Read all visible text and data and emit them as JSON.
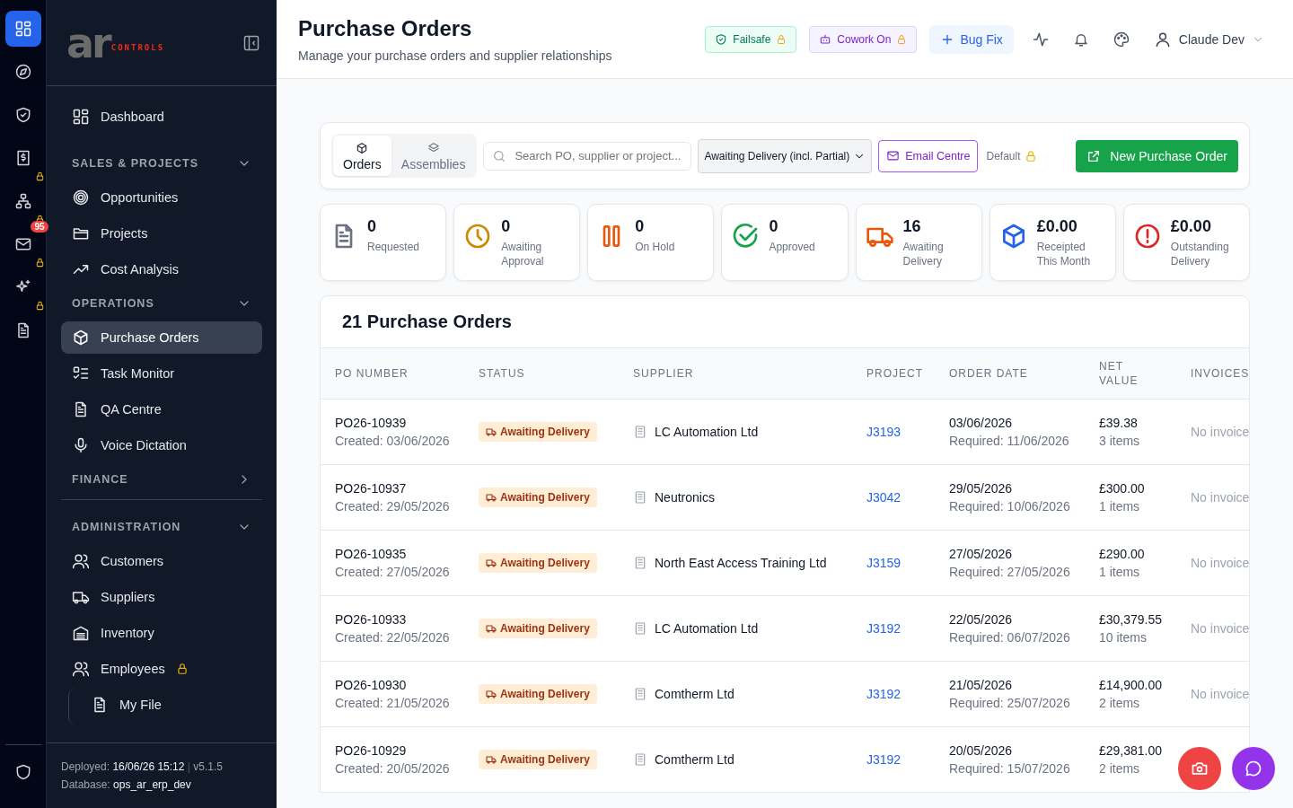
{
  "rail": {
    "items": [
      {
        "selected": true,
        "locked": false
      },
      {
        "selected": false,
        "locked": false
      },
      {
        "selected": false,
        "locked": false
      },
      {
        "selected": false,
        "locked": true
      },
      {
        "selected": false,
        "locked": true
      },
      {
        "selected": false,
        "locked": true,
        "badge": "95"
      },
      {
        "selected": false,
        "locked": true
      },
      {
        "selected": false,
        "locked": false
      }
    ]
  },
  "sidebar": {
    "logo": {
      "mark": "ar",
      "word": "CONTROLS"
    },
    "nav": [
      {
        "kind": "item",
        "label": "Dashboard",
        "selected": false,
        "locked": false
      },
      {
        "kind": "section",
        "label": "SALES & PROJECTS",
        "expanded": true,
        "children": [
          {
            "label": "Opportunities",
            "selected": false,
            "locked": false
          },
          {
            "label": "Projects",
            "selected": false,
            "locked": false
          },
          {
            "label": "Cost Analysis",
            "selected": false,
            "locked": false
          }
        ]
      },
      {
        "kind": "section",
        "label": "OPERATIONS",
        "expanded": true,
        "children": [
          {
            "label": "Purchase Orders",
            "selected": true,
            "locked": false
          },
          {
            "label": "Task Monitor",
            "selected": false,
            "locked": false
          },
          {
            "label": "QA Centre",
            "selected": false,
            "locked": false
          },
          {
            "label": "Voice Dictation",
            "selected": false,
            "locked": false
          }
        ]
      },
      {
        "kind": "section",
        "label": "FINANCE",
        "expanded": false
      },
      {
        "kind": "divider"
      },
      {
        "kind": "section",
        "label": "ADMINISTRATION",
        "expanded": true,
        "children": [
          {
            "label": "Customers",
            "selected": false,
            "locked": false
          },
          {
            "label": "Suppliers",
            "selected": false,
            "locked": false
          },
          {
            "label": "Inventory",
            "selected": false,
            "locked": false
          },
          {
            "label": "Employees",
            "selected": false,
            "locked": true,
            "children": [
              {
                "label": "My File",
                "selected": false,
                "locked": false
              }
            ]
          }
        ]
      }
    ],
    "footer": {
      "deployed_label": "Deployed:",
      "deployed": "16/06/26 15:12",
      "separator": "|",
      "version": "v5.1.5",
      "database_label": "Database:",
      "database": "ops_ar_erp_dev"
    }
  },
  "header": {
    "title": "Purchase Orders",
    "subtitle": "Manage your purchase orders and supplier relationships",
    "badges": [
      {
        "label": "Failsafe",
        "kind": "failsafe",
        "locked": true
      },
      {
        "label": "Cowork On",
        "kind": "cowork",
        "locked": true
      }
    ],
    "bug_fix": {
      "label": "Bug Fix"
    },
    "user": {
      "name": "Claude Dev"
    }
  },
  "toolbar": {
    "tabs": [
      {
        "label": "Orders",
        "selected": true
      },
      {
        "label": "Assemblies",
        "selected": false
      }
    ],
    "search": {
      "placeholder": "Search PO, supplier or project..."
    },
    "status_filter": {
      "value": "Awaiting Delivery (incl. Partial)"
    },
    "email_centre": {
      "label": "Email Centre"
    },
    "view": {
      "label": "Default",
      "locked": true
    },
    "new_button": {
      "label": "New Purchase Order"
    }
  },
  "stats": [
    {
      "value": "0",
      "label": "Requested",
      "color": "#6b7280"
    },
    {
      "value": "0",
      "label": "Awaiting Approval",
      "color": "#ca8a04"
    },
    {
      "value": "0",
      "label": "On Hold",
      "color": "#ea580c"
    },
    {
      "value": "0",
      "label": "Approved",
      "color": "#16a34a"
    },
    {
      "value": "16",
      "label": "Awaiting Delivery",
      "color": "#ea580c"
    },
    {
      "value": "£0.00",
      "label": "Receipted This Month",
      "color": "#2563eb"
    },
    {
      "value": "£0.00",
      "label": "Outstanding Delivery",
      "color": "#dc2626"
    }
  ],
  "table": {
    "title": "21 Purchase Orders",
    "columns": [
      "PO NUMBER",
      "STATUS",
      "SUPPLIER",
      "PROJECT",
      "ORDER DATE",
      "NET VALUE",
      "INVOICES"
    ],
    "rows": [
      {
        "po": "PO26-10939",
        "created": "Created: 03/06/2026",
        "status": "Awaiting Delivery",
        "supplier": "LC Automation Ltd",
        "project": "J3193",
        "order_date": "03/06/2026",
        "required": "Required: 11/06/2026",
        "net": "£39.38",
        "items": "3 items",
        "invoices": "No invoice"
      },
      {
        "po": "PO26-10937",
        "created": "Created: 29/05/2026",
        "status": "Awaiting Delivery",
        "supplier": "Neutronics",
        "project": "J3042",
        "order_date": "29/05/2026",
        "required": "Required: 10/06/2026",
        "net": "£300.00",
        "items": "1 items",
        "invoices": "No invoice"
      },
      {
        "po": "PO26-10935",
        "created": "Created: 27/05/2026",
        "status": "Awaiting Delivery",
        "supplier": "North East Access Training Ltd",
        "project": "J3159",
        "order_date": "27/05/2026",
        "required": "Required: 27/05/2026",
        "net": "£290.00",
        "items": "1 items",
        "invoices": "No invoice"
      },
      {
        "po": "PO26-10933",
        "created": "Created: 22/05/2026",
        "status": "Awaiting Delivery",
        "supplier": "LC Automation Ltd",
        "project": "J3192",
        "order_date": "22/05/2026",
        "required": "Required: 06/07/2026",
        "net": "£30,379.55",
        "items": "10 items",
        "invoices": "No invoice"
      },
      {
        "po": "PO26-10930",
        "created": "Created: 21/05/2026",
        "status": "Awaiting Delivery",
        "supplier": "Comtherm Ltd",
        "project": "J3192",
        "order_date": "21/05/2026",
        "required": "Required: 25/07/2026",
        "net": "£14,900.00",
        "items": "2 items",
        "invoices": "No invoice"
      },
      {
        "po": "PO26-10929",
        "created": "Created: 20/05/2026",
        "status": "Awaiting Delivery",
        "supplier": "Comtherm Ltd",
        "project": "J3192",
        "order_date": "20/05/2026",
        "required": "Required: 15/07/2026",
        "net": "£29,381.00",
        "items": "2 items"
      }
    ]
  },
  "fabs": [
    {
      "color": "#ef4444"
    },
    {
      "color": "#9333ea"
    }
  ]
}
